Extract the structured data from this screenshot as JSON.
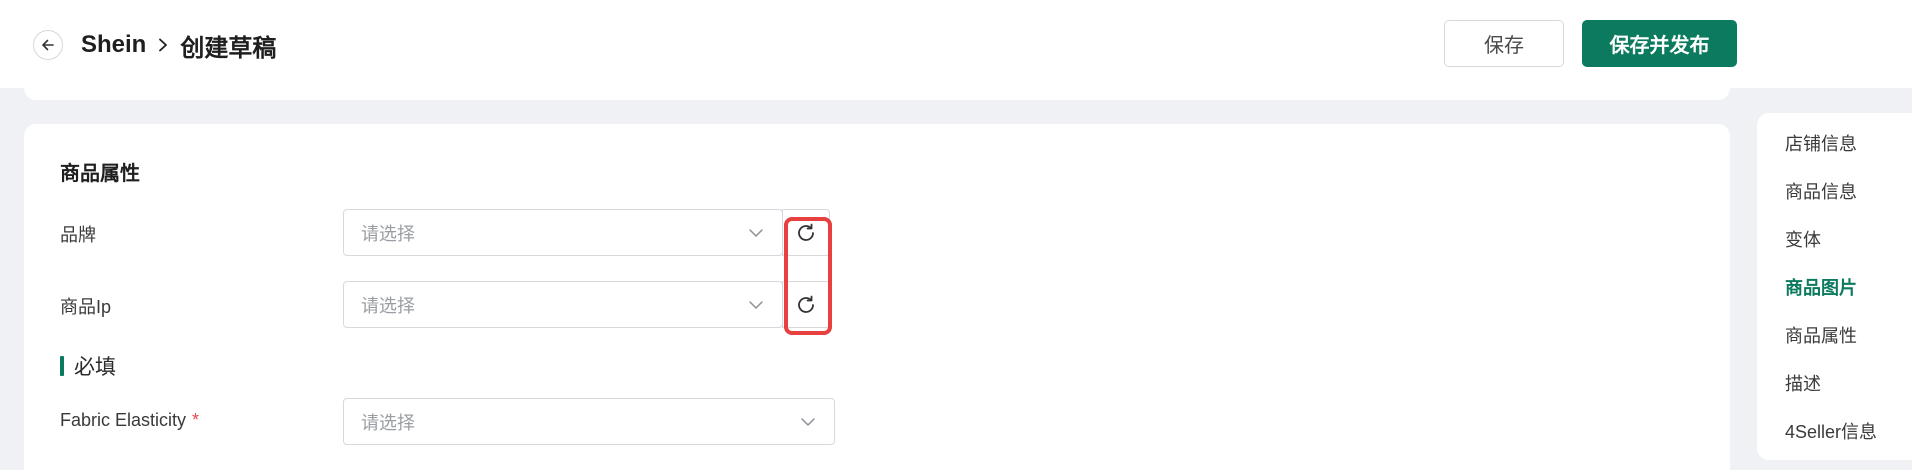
{
  "header": {
    "platform": "Shein",
    "page": "创建草稿",
    "save_label": "保存",
    "publish_label": "保存并发布"
  },
  "section": {
    "title": "商品属性",
    "fields": [
      {
        "label": "品牌",
        "placeholder": "请选择"
      },
      {
        "label": "商品Ip",
        "placeholder": "请选择"
      }
    ],
    "required_group": {
      "title": "必填",
      "fields": [
        {
          "label": "Fabric Elasticity",
          "required_mark": "*",
          "placeholder": "请选择"
        }
      ]
    }
  },
  "side_nav": {
    "items": [
      {
        "label": "店铺信息",
        "active": false
      },
      {
        "label": "商品信息",
        "active": false
      },
      {
        "label": "变体",
        "active": false
      },
      {
        "label": "商品图片",
        "active": true
      },
      {
        "label": "商品属性",
        "active": false
      },
      {
        "label": "描述",
        "active": false
      },
      {
        "label": "4Seller信息",
        "active": false
      }
    ]
  },
  "colors": {
    "accent": "#0b7a5f",
    "highlight": "#e8403f",
    "required": "#e5484d",
    "background": "#f0f1f5"
  },
  "icons": [
    "back-arrow-icon",
    "chevron-right-icon",
    "chevron-down-icon",
    "refresh-icon"
  ]
}
